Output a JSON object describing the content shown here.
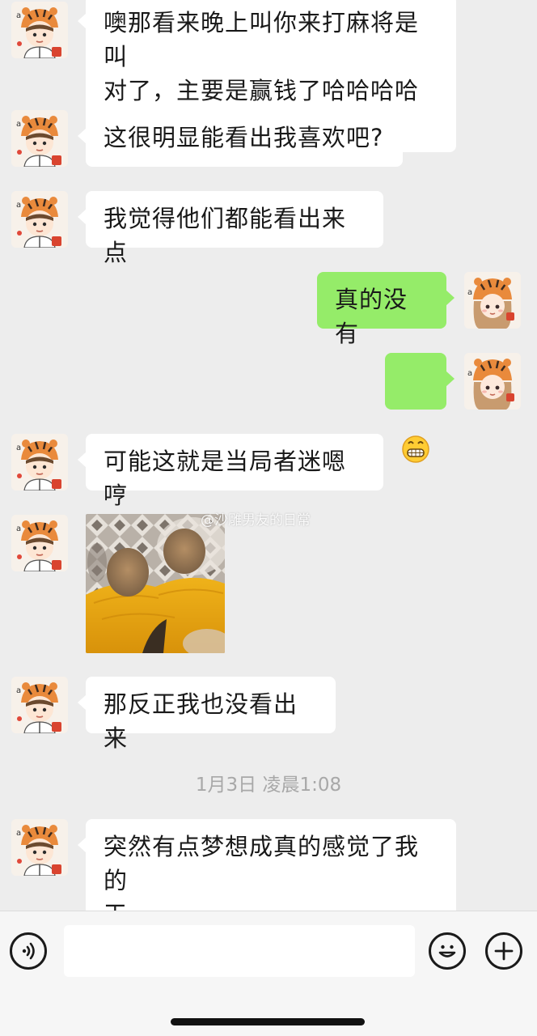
{
  "messages": [
    {
      "sender": "other",
      "text": "噢那看来晚上叫你来打麻将是叫\n对了，主要是赢钱了哈哈哈哈哈"
    },
    {
      "sender": "other",
      "text": "这很明显能看出我喜欢吧?"
    },
    {
      "sender": "other",
      "text": "我觉得他们都能看出来点"
    },
    {
      "sender": "me",
      "text": "真的没有"
    },
    {
      "sender": "me",
      "emoji": "grin-emoji"
    },
    {
      "sender": "other",
      "text": "可能这就是当局者迷嗯哼"
    },
    {
      "sender": "other",
      "image": "sweater-photo",
      "watermark": "@沙雕男友的日常"
    },
    {
      "sender": "other",
      "text": "那反正我也没看出来"
    },
    {
      "sender": "other",
      "text": "突然有点梦想成真的感觉了我的\n天"
    }
  ],
  "timestamp": "1月3日 凌晨1:08",
  "input_bar": {
    "value": "",
    "voice_icon": "voice-icon",
    "emoji_icon": "emoji-icon",
    "plus_icon": "plus-icon"
  },
  "colors": {
    "background": "#ededed",
    "incoming_bubble": "#ffffff",
    "outgoing_bubble": "#95ec69",
    "timestamp": "#a8a8a8"
  }
}
